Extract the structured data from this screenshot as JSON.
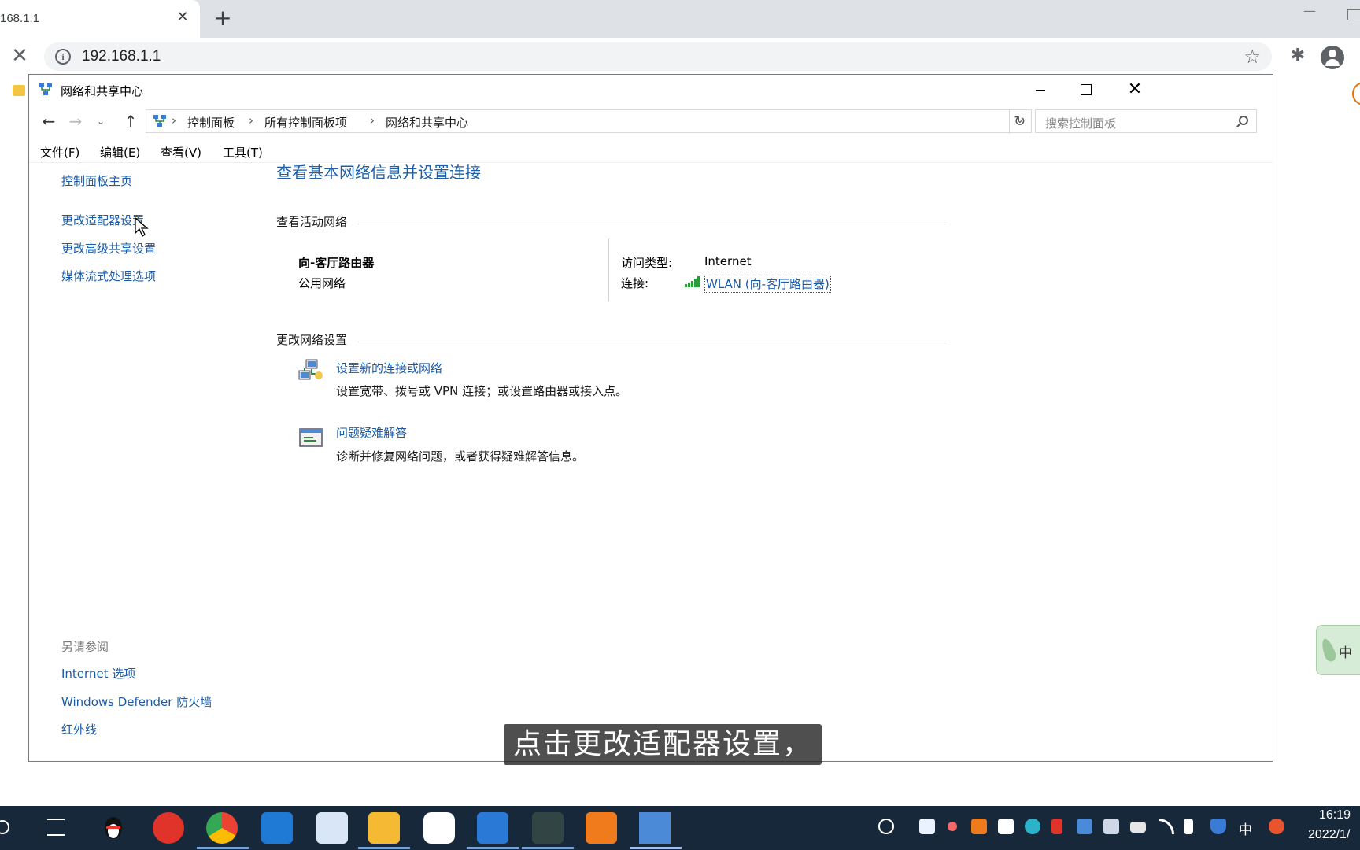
{
  "browser": {
    "tab_title": "168.1.1",
    "url": "192.168.1.1"
  },
  "window": {
    "title": "网络和共享中心",
    "breadcrumb": [
      "控制面板",
      "所有控制面板项",
      "网络和共享中心"
    ],
    "search_placeholder": "搜索控制面板",
    "menu": [
      "文件(F)",
      "编辑(E)",
      "查看(V)",
      "工具(T)"
    ]
  },
  "left_pane": {
    "links": [
      "控制面板主页",
      "更改适配器设置",
      "更改高级共享设置",
      "媒体流式处理选项"
    ],
    "see_also_title": "另请参阅",
    "see_also": [
      "Internet 选项",
      "Windows Defender 防火墙",
      "红外线"
    ]
  },
  "main": {
    "title": "查看基本网络信息并设置连接",
    "active_networks_title": "查看活动网络",
    "network": {
      "name": "向-客厅路由器",
      "type": "公用网络",
      "access_label": "访问类型:",
      "access_value": "Internet",
      "connection_label": "连接:",
      "connection_value": "WLAN (向-客厅路由器)"
    },
    "change_settings_title": "更改网络设置",
    "tasks": [
      {
        "title": "设置新的连接或网络",
        "desc": "设置宽带、拨号或 VPN 连接；或设置路由器或接入点。",
        "icon": "network-setup-icon"
      },
      {
        "title": "问题疑难解答",
        "desc": "诊断并修复网络问题，或者获得疑难解答信息。",
        "icon": "troubleshoot-icon"
      }
    ]
  },
  "ime_widget": {
    "char": "中"
  },
  "subtitle": "点击更改适配器设置，",
  "taskbar": {
    "ime": "中",
    "time": "16:19",
    "date": "2022/1/"
  },
  "colors": {
    "link": "#1a5aa6",
    "title_blue": "#1e5fa8",
    "taskbar": "#17283a"
  }
}
